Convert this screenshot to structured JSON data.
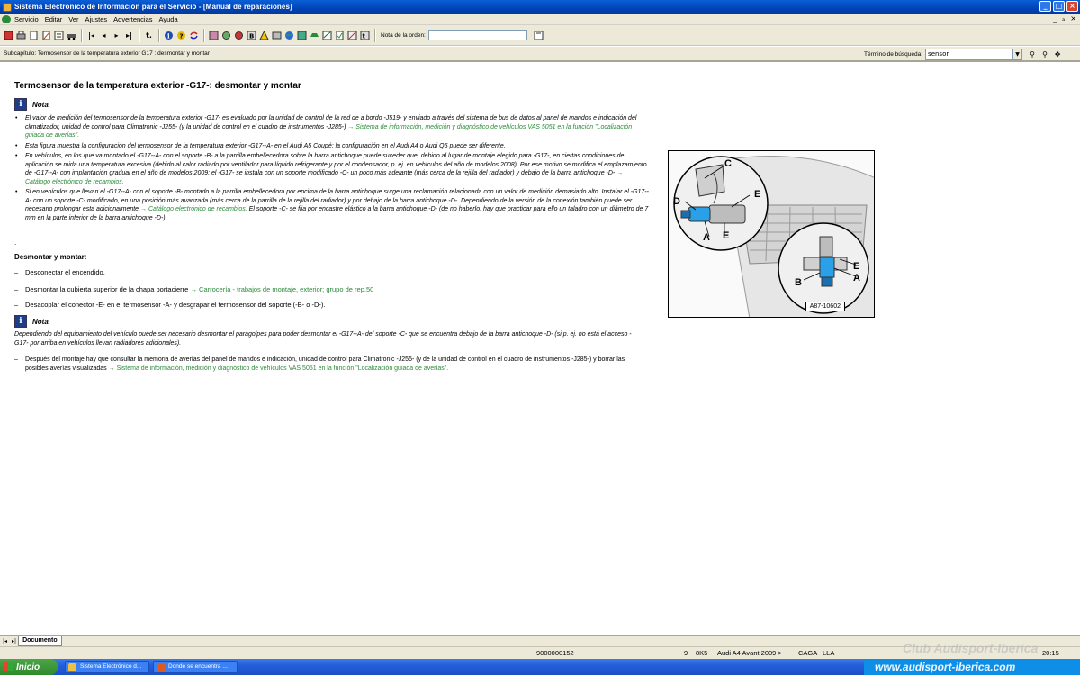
{
  "window": {
    "title": "Sistema Electrónico de Información para el Servicio - [Manual de reparaciones]",
    "minimize": "_",
    "maximize": "□",
    "close": "×"
  },
  "menu": {
    "items": [
      "Servicio",
      "Editar",
      "Ver",
      "Ajustes",
      "Advertencias",
      "Ayuda"
    ],
    "mdi_minimize": "_",
    "mdi_restore": "ₐ",
    "mdi_close": "×"
  },
  "toolbar": {
    "order_note_label": "Nota de la orden:",
    "order_note_value": ""
  },
  "subchapter": {
    "text": "Subcapítulo: Termosensor de la temperatura exterior G17 : desmontar y montar",
    "search_label": "Término de búsqueda:",
    "search_value": "sensor"
  },
  "document": {
    "title": "Termosensor de la temperatura exterior -G17-: desmontar y montar",
    "note_label": "Nota",
    "bullets": [
      {
        "text": "El valor de medición del termosensor de la temperatura exterior -G17- es evaluado por la unidad de control de la red de a bordo -J519- y enviado a través del sistema de bus de datos al panel de mandos e indicación del climatizador, unidad de control para Climatronic -J255- (y la unidad de control en el cuadro de instrumentos -J285-)",
        "link": "→ Sistema de información, medición y diagnóstico de vehículos VAS 5051 en la función \"Localización guiada de averías\"."
      },
      {
        "text": "Esta figura muestra la configuración del termosensor de la temperatura exterior -G17--A- en el Audi A5 Coupé; la configuración en el Audi A4 o Audi Q5 puede ser diferente.",
        "link": ""
      },
      {
        "text": "En vehículos, en los que va montado el -G17--A- con el soporte -B- a la parrilla embellecedora sobre la barra antichoque puede suceder que, debido al lugar de montaje elegido para -G17-, en ciertas condiciones de aplicación se mida una temperatura excesiva (debido al calor radiado por ventilador para líquido refrigerante y por el condensador, p. ej. en vehículos del año de modelos 2008). Por ese motivo se modifica el emplazamiento de -G17--A- con implantación gradual en el año de modelos 2009; el -G17- se instala con un soporte modificado -C- un poco más adelante (más cerca de la rejilla del radiador) y debajo de la barra antichoque -D-",
        "link": "→ Catálogo electrónico de recambios."
      },
      {
        "text": "Si en vehículos que llevan el -G17--A- con el soporte -B- montado a la parrilla embellecedora por encima de la barra antichoque surge una reclamación relacionada con un valor de medición demasiado alto. Instalar el -G17--A- con un soporte -C- modificado, en una posición más avanzada (más cerca de la parrilla de la rejilla del radiador) y por debajo de la barra antichoque -D-. Dependiendo de la versión de la conexión también puede ser necesario prolongar esta adicionalmente",
        "link": "→ Catálogo electrónico de recambios.",
        "tail": " El soporte -C- se fija por encastre elástico a la barra antichoque -D- (de no haberlo, hay que practicar para ello un taladro con un diámetro de 7 mm en la parte inferior de la barra antichoque -D-)."
      }
    ],
    "dot": ".",
    "section_title": "Desmontar y montar:",
    "steps": [
      {
        "text": "Desconectar el encendido.",
        "link": ""
      },
      {
        "text": "Desmontar la cubierta superior de la chapa portacierre",
        "link": "→ Carrocería - trabajos de montaje, exterior; grupo de rep.50"
      },
      {
        "text": "Desacoplar el conector -E- en el termosensor -A- y desgrapar el termosensor del soporte (-B- o -D-).",
        "link": ""
      }
    ],
    "note2_label": "Nota",
    "note2_text": "Dependiendo del equipamiento del vehículo puede ser necesario desmontar el paragolpes para poder desmontar el -G17--A- del soporte -C- que se encuentra debajo de la barra antichoque -D- (si p. ej. no está el acceso -G17- por arriba en vehículos llevan radiadores adicionales).",
    "final_step": {
      "text": "Después del montaje hay que consultar la memoria de averías del panel de mandos e indicación, unidad de control para Climatronic -J255- (y de la unidad de control en el cuadro de instrumentos -J285-) y borrar las posibles averías visualizadas",
      "link": "→ Sistema de información, medición y diagnóstico de vehículos VAS 5051 en la función \"Localización guiada de averías\"."
    }
  },
  "figure": {
    "caption": "A87-10602",
    "labels": [
      "C",
      "D",
      "E",
      "A",
      "E",
      "E",
      "B",
      "A"
    ]
  },
  "tabs": {
    "active": "Documento"
  },
  "status": {
    "doc_number": "9000000152",
    "page": "9",
    "model_code": "8K5",
    "model": "Audi A4 Avant 2009 >",
    "engine": "CAGA",
    "region": "LLA",
    "time": "20:15"
  },
  "taskbar": {
    "start": "Inicio",
    "tasks": [
      "Sistema Electrónico d...",
      "Donde se encuentra ..."
    ],
    "watermark_club": "Club Audisport-Iberica",
    "watermark_url": "www.audisport-iberica.com"
  },
  "colors": {
    "link": "#2b8a3a",
    "titlebar": "#0a5fd8",
    "chrome": "#ece9d8"
  }
}
